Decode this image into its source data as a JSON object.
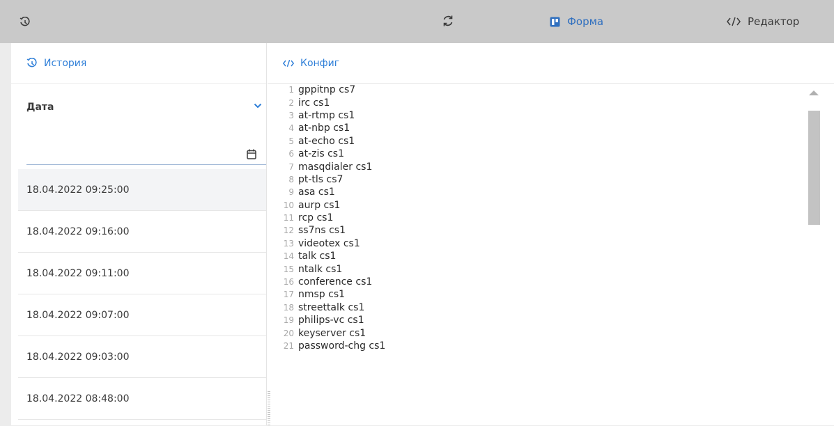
{
  "toolbar": {
    "history_icon": "history-icon",
    "refresh_icon": "refresh-icon",
    "form_label": "Форма",
    "editor_label": "Редактор"
  },
  "history": {
    "title": "История",
    "date_label": "Дата",
    "date_value": "",
    "items": [
      "18.04.2022 09:25:00",
      "18.04.2022 09:16:00",
      "18.04.2022 09:11:00",
      "18.04.2022 09:07:00",
      "18.04.2022 09:03:00",
      "18.04.2022 08:48:00"
    ],
    "selected_index": 0
  },
  "config": {
    "title": "Конфиг",
    "lines": [
      "gppitnp cs7",
      "irc cs1",
      "at-rtmp cs1",
      "at-nbp cs1",
      "at-echo cs1",
      "at-zis cs1",
      "masqdialer cs1",
      "pt-tls cs7",
      "asa cs1",
      "aurp cs1",
      "rcp cs1",
      "ss7ns cs1",
      "videotex cs1",
      "talk cs1",
      "ntalk cs1",
      "conference cs1",
      "nmsp cs1",
      "streettalk cs1",
      "philips-vc cs1",
      "keyserver cs1",
      "password-chg cs1"
    ]
  },
  "colors": {
    "accent": "#2f7fd8",
    "overlay": "#c9c9c9",
    "selected_row": "#f3f4f6"
  }
}
